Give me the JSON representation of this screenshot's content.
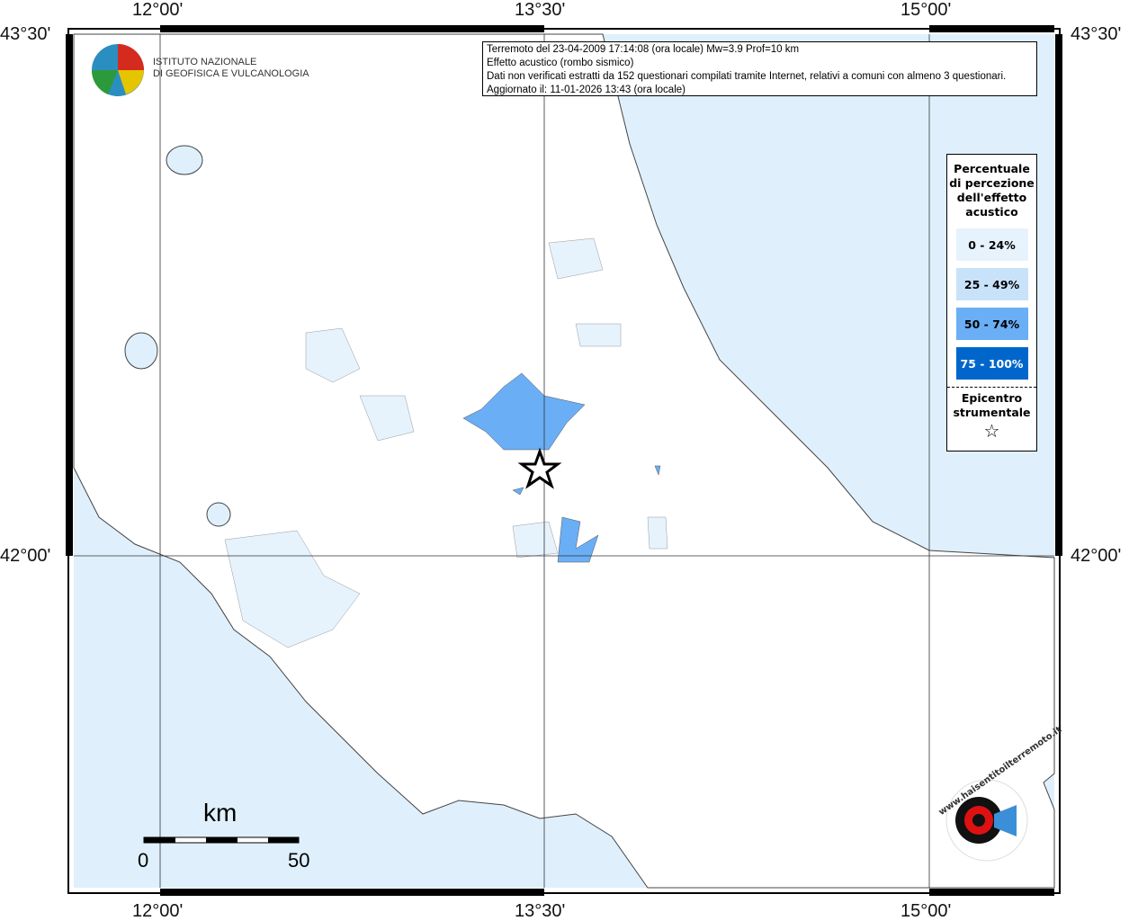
{
  "info": {
    "line1": "Terremoto del 23-04-2009 17:14:08 (ora locale) Mw=3.9 Prof=10 km",
    "line2": "Effetto acustico (rombo sismico)",
    "line3": "Dati non verificati estratti da 152 questionari compilati tramite Internet, relativi a comuni con almeno 3 questionari.",
    "line4": "Aggiornato il: 11-01-2026 13:43 (ora locale)"
  },
  "axes": {
    "lon": [
      "12°00'",
      "13°30'",
      "15°00'"
    ],
    "lat": [
      "43°30'",
      "42°00'"
    ]
  },
  "legend": {
    "title": "Percentuale di percezione dell'effetto acustico",
    "classes": [
      {
        "label": "0 - 24%",
        "color": "#e6f3fd"
      },
      {
        "label": "25 - 49%",
        "color": "#c8e2fa"
      },
      {
        "label": "50 - 74%",
        "color": "#6aaef5"
      },
      {
        "label": "75 - 100%",
        "color": "#0066cc"
      }
    ],
    "epicenter_label": "Epicentro strumentale"
  },
  "logo": {
    "line1": "ISTITUTO NAZIONALE",
    "line2": "DI GEOFISICA E VULCANOLOGIA"
  },
  "hst_logo": "www.haisentitoilterremoto.it",
  "scale": {
    "unit": "km",
    "min": "0",
    "max": "50"
  },
  "colors": {
    "sea": "#dff0fc",
    "land": "#ffffff"
  }
}
